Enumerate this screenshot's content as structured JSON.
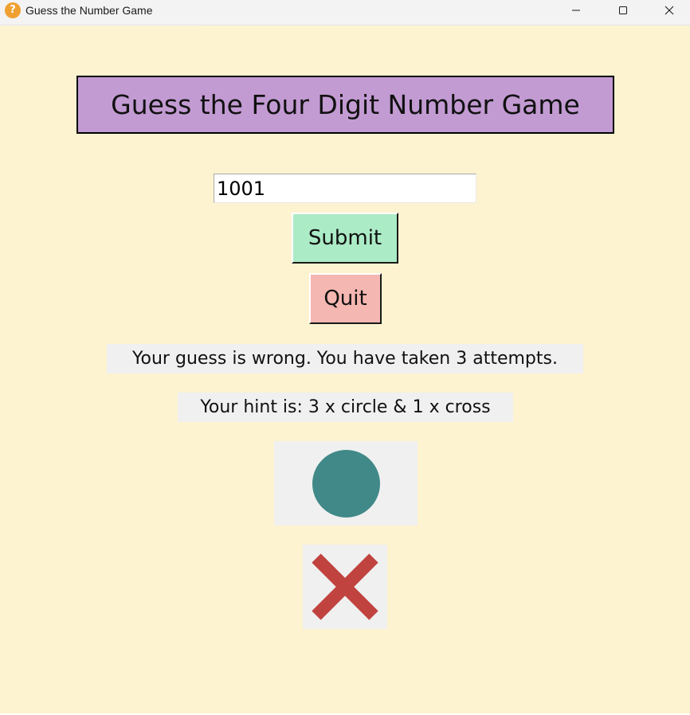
{
  "window": {
    "title": "Guess the Number Game",
    "app_icon_glyph": "?",
    "app_icon_name": "question-mark-icon",
    "controls": [
      "minimize-icon",
      "maximize-icon",
      "close-icon"
    ]
  },
  "game": {
    "heading": "Guess the Four Digit Number Game",
    "guess_input": {
      "value": "1001",
      "placeholder": ""
    },
    "submit_label": "Submit",
    "quit_label": "Quit",
    "status_message": "Your guess is wrong. You have taken 3 attempts.",
    "hint_message": "Your hint is: 3 x circle & 1 x cross",
    "hint_symbols": [
      {
        "name": "circle-icon",
        "color": "#408988"
      },
      {
        "name": "cross-icon",
        "color": "#c0433f"
      }
    ]
  },
  "colors": {
    "background": "#fdf3d0",
    "heading_bg": "#c39bd3",
    "submit_bg": "#abebc6",
    "quit_bg": "#f5b7b1",
    "message_bg": "#f0f0f0"
  }
}
